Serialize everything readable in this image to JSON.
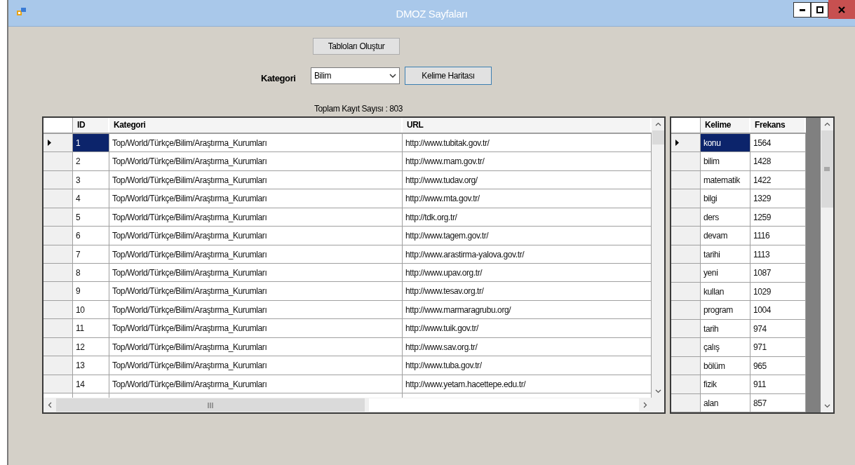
{
  "window": {
    "title": "DMOZ Sayfaları"
  },
  "controls": {
    "create_button": "Tabloları Oluştur",
    "category_label": "Kategori",
    "category_combo": {
      "value": "Bilim"
    },
    "word_map_button": "Kelime Haritası",
    "record_count": "Toplam Kayıt Sayısı : 803"
  },
  "pages_table": {
    "columns": [
      "ID",
      "Kategori",
      "URL"
    ],
    "rows": [
      {
        "cells": [
          "1",
          "Top/World/Türkçe/Bilim/Araştırma_Kurumları",
          "http://www.tubitak.gov.tr/"
        ],
        "selected": true
      },
      {
        "cells": [
          "2",
          "Top/World/Türkçe/Bilim/Araştırma_Kurumları",
          "http://www.mam.gov.tr/"
        ],
        "selected": false
      },
      {
        "cells": [
          "3",
          "Top/World/Türkçe/Bilim/Araştırma_Kurumları",
          "http://www.tudav.org/"
        ],
        "selected": false
      },
      {
        "cells": [
          "4",
          "Top/World/Türkçe/Bilim/Araştırma_Kurumları",
          "http://www.mta.gov.tr/"
        ],
        "selected": false
      },
      {
        "cells": [
          "5",
          "Top/World/Türkçe/Bilim/Araştırma_Kurumları",
          "http://tdk.org.tr/"
        ],
        "selected": false
      },
      {
        "cells": [
          "6",
          "Top/World/Türkçe/Bilim/Araştırma_Kurumları",
          "http://www.tagem.gov.tr/"
        ],
        "selected": false
      },
      {
        "cells": [
          "7",
          "Top/World/Türkçe/Bilim/Araştırma_Kurumları",
          "http://www.arastirma-yalova.gov.tr/"
        ],
        "selected": false
      },
      {
        "cells": [
          "8",
          "Top/World/Türkçe/Bilim/Araştırma_Kurumları",
          "http://www.upav.org.tr/"
        ],
        "selected": false
      },
      {
        "cells": [
          "9",
          "Top/World/Türkçe/Bilim/Araştırma_Kurumları",
          "http://www.tesav.org.tr/"
        ],
        "selected": false
      },
      {
        "cells": [
          "10",
          "Top/World/Türkçe/Bilim/Araştırma_Kurumları",
          "http://www.marmaragrubu.org/"
        ],
        "selected": false
      },
      {
        "cells": [
          "11",
          "Top/World/Türkçe/Bilim/Araştırma_Kurumları",
          "http://www.tuik.gov.tr/"
        ],
        "selected": false
      },
      {
        "cells": [
          "12",
          "Top/World/Türkçe/Bilim/Araştırma_Kurumları",
          "http://www.sav.org.tr/"
        ],
        "selected": false
      },
      {
        "cells": [
          "13",
          "Top/World/Türkçe/Bilim/Araştırma_Kurumları",
          "http://www.tuba.gov.tr/"
        ],
        "selected": false
      },
      {
        "cells": [
          "14",
          "Top/World/Türkçe/Bilim/Araştırma_Kurumları",
          "http://www.yetam.hacettepe.edu.tr/"
        ],
        "selected": false
      }
    ]
  },
  "words_table": {
    "columns": [
      "Kelime",
      "Frekans"
    ],
    "rows": [
      {
        "cells": [
          "konu",
          "1564"
        ],
        "selected": true
      },
      {
        "cells": [
          "bilim",
          "1428"
        ],
        "selected": false
      },
      {
        "cells": [
          "matematik",
          "1422"
        ],
        "selected": false
      },
      {
        "cells": [
          "bilgi",
          "1329"
        ],
        "selected": false
      },
      {
        "cells": [
          "ders",
          "1259"
        ],
        "selected": false
      },
      {
        "cells": [
          "devam",
          "1116"
        ],
        "selected": false
      },
      {
        "cells": [
          "tarihi",
          "1113"
        ],
        "selected": false
      },
      {
        "cells": [
          "yeni",
          "1087"
        ],
        "selected": false
      },
      {
        "cells": [
          "kullan",
          "1029"
        ],
        "selected": false
      },
      {
        "cells": [
          "program",
          "1004"
        ],
        "selected": false
      },
      {
        "cells": [
          "tarih",
          "974"
        ],
        "selected": false
      },
      {
        "cells": [
          "çalış",
          "971"
        ],
        "selected": false
      },
      {
        "cells": [
          "bölüm",
          "965"
        ],
        "selected": false
      },
      {
        "cells": [
          "fizik",
          "911"
        ],
        "selected": false
      },
      {
        "cells": [
          "alan",
          "857"
        ],
        "selected": false
      }
    ]
  }
}
